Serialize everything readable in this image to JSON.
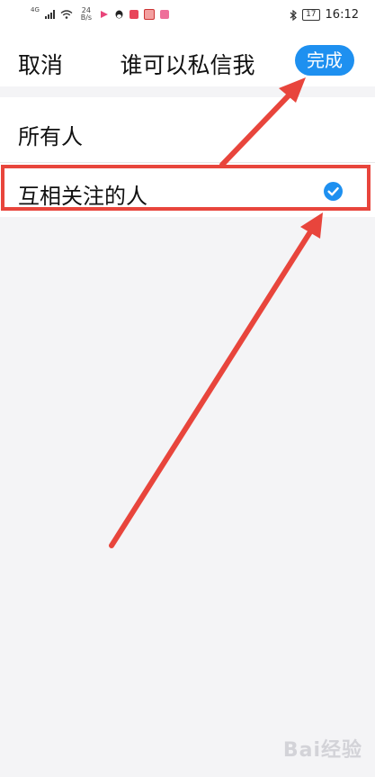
{
  "status_bar": {
    "network_type": "4G",
    "speed_value": "24",
    "speed_unit": "B/s",
    "battery": "17",
    "time": "16:12"
  },
  "nav": {
    "cancel_label": "取消",
    "title": "谁可以私信我",
    "done_label": "完成"
  },
  "options": [
    {
      "label": "所有人",
      "selected": false
    },
    {
      "label": "互相关注的人",
      "selected": true
    }
  ],
  "colors": {
    "accent": "#1e90f0",
    "annotation": "#e8453c",
    "background": "#f4f4f6"
  },
  "watermark": "Bai经验"
}
